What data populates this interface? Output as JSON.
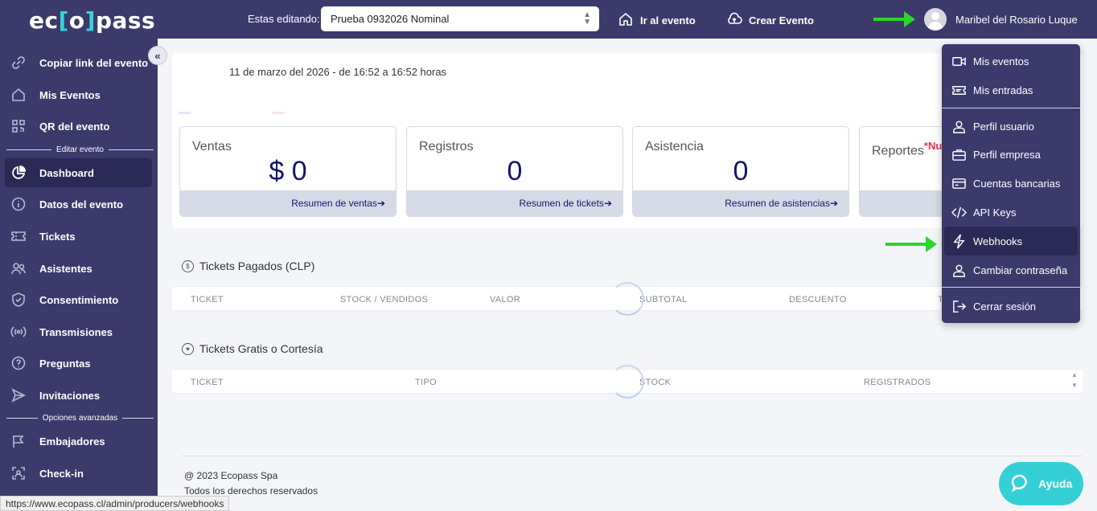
{
  "header": {
    "logo_left": "ec",
    "logo_o": "o",
    "logo_right": "pass",
    "editing_label": "Estas editando:",
    "event_select_value": "Prueba 0932026 Nominal",
    "go_to_event": "Ir al evento",
    "create_event": "Crear Evento",
    "user_name": "Maribel del Rosario Luque"
  },
  "sidebar": {
    "items_top": [
      {
        "label": "Copiar link del evento",
        "icon": "link-icon"
      },
      {
        "label": "Mis Eventos",
        "icon": "home-icon"
      },
      {
        "label": "QR del evento",
        "icon": "qr-icon"
      }
    ],
    "section_edit": "Editar evento",
    "items_edit": [
      {
        "label": "Dashboard",
        "icon": "pie-chart-icon",
        "active": true
      },
      {
        "label": "Datos del evento",
        "icon": "info-icon"
      },
      {
        "label": "Tickets",
        "icon": "ticket-icon"
      },
      {
        "label": "Asistentes",
        "icon": "users-icon"
      },
      {
        "label": "Consentimiento",
        "icon": "shield-icon"
      },
      {
        "label": "Transmisiones",
        "icon": "broadcast-icon"
      },
      {
        "label": "Preguntas",
        "icon": "question-icon"
      },
      {
        "label": "Invitaciones",
        "icon": "send-icon"
      }
    ],
    "section_advanced": "Opciones avanzadas",
    "items_advanced": [
      {
        "label": "Embajadores",
        "icon": "flag-icon"
      },
      {
        "label": "Check-in",
        "icon": "scan-icon"
      }
    ]
  },
  "main": {
    "date_line": "11 de marzo del 2026  -  de 16:52 a 16:52 horas",
    "stats": [
      {
        "title": "Ventas",
        "value": "$ 0",
        "link": "Resumen de ventas"
      },
      {
        "title": "Registros",
        "value": "0",
        "link": "Resumen de tickets"
      },
      {
        "title": "Asistencia",
        "value": "0",
        "link": "Resumen de asistencias"
      },
      {
        "title": "Reportes",
        "value": "",
        "link": ""
      }
    ],
    "reportes_badge": "*Nu",
    "paid_title": "Tickets Pagados (CLP)",
    "paid_columns": [
      "TICKET",
      "STOCK / VENDIDOS",
      "VALOR",
      "SUBTOTAL",
      "DESCUENTO",
      "T"
    ],
    "free_title": "Tickets Gratis o Cortesía",
    "free_columns": [
      "TICKET",
      "TIPO",
      "STOCK",
      "REGISTRADOS"
    ]
  },
  "footer": {
    "copyright": "@ 2023 Ecopass Spa",
    "rights": "Todos los derechos reservados"
  },
  "status_url": "https://www.ecopass.cl/admin/producers/webhooks",
  "help_label": "Ayuda",
  "user_menu": {
    "group1": [
      {
        "label": "Mis eventos",
        "icon": "video-icon"
      },
      {
        "label": "Mis entradas",
        "icon": "ticket-icon"
      }
    ],
    "group2": [
      {
        "label": "Perfil usuario",
        "icon": "user-icon"
      },
      {
        "label": "Perfil empresa",
        "icon": "briefcase-icon"
      },
      {
        "label": "Cuentas bancarias",
        "icon": "credit-card-icon"
      },
      {
        "label": "API Keys",
        "icon": "code-icon"
      },
      {
        "label": "Webhooks",
        "icon": "lightning-icon",
        "hover": true
      },
      {
        "label": "Cambiar contraseña",
        "icon": "user-icon"
      }
    ],
    "group3": [
      {
        "label": "Cerrar sesión",
        "icon": "logout-icon"
      }
    ]
  },
  "colors": {
    "primary": "#3b3a6b",
    "primary_dark": "#2b2a55",
    "accent": "#35d0d5",
    "annotation_arrow": "#2bd62b",
    "stat_value": "#14146e"
  }
}
